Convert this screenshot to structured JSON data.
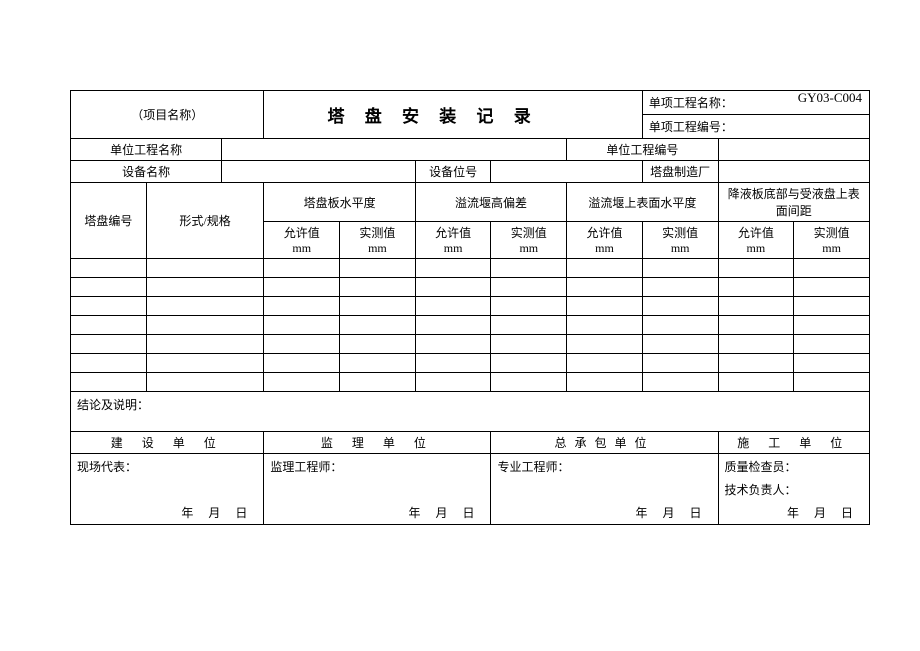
{
  "form_code": "GY03-C004",
  "header": {
    "project_name_label": "（项目名称）",
    "title": "塔 盘 安 装 记 录",
    "single_proj_name_label": "单项工程名称：",
    "single_proj_code_label": "单项工程编号："
  },
  "row_unit": {
    "unit_proj_name_label": "单位工程名称",
    "unit_proj_code_label": "单位工程编号"
  },
  "row_device": {
    "device_name_label": "设备名称",
    "device_pos_label": "设备位号",
    "manufacturer_label": "塔盘制造厂"
  },
  "columns": {
    "tray_no": "塔盘编号",
    "form_spec": "形式/规格",
    "group1": "塔盘板水平度",
    "group2": "溢流堰高偏差",
    "group3": "溢流堰上表面水平度",
    "group4": "降液板底部与受液盘上表面间距",
    "allow_mm": "允许值\nmm",
    "meas_mm": "实测值\nmm",
    "allow": "允许值",
    "meas": "实测值",
    "mm": "mm"
  },
  "conclusion_label": "结论及说明：",
  "signatures": {
    "construction_unit": "建 设 单 位",
    "supervision_unit": "监 理 单 位",
    "general_contractor": "总承包单位",
    "builder_unit": "施 工 单 位",
    "site_rep": "现场代表：",
    "supervisor_eng": "监理工程师：",
    "prof_eng": "专业工程师：",
    "qc_inspector": "质量检查员：",
    "tech_lead": "技术负责人：",
    "date_ymd": "年  月  日"
  }
}
